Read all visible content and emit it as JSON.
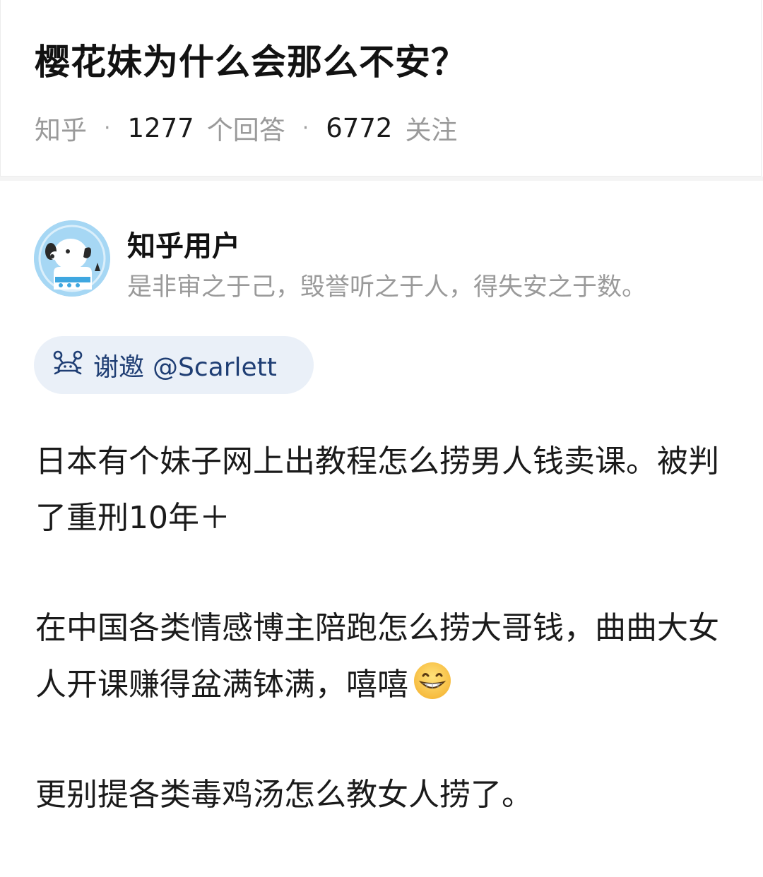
{
  "question": {
    "title": "樱花妹为什么会那么不安？",
    "source": "知乎",
    "answers_count": "1277",
    "answers_label": "个回答",
    "followers_count": "6772",
    "followers_label": "关注"
  },
  "author": {
    "name": "知乎用户",
    "bio": "是非审之于己，毁誉听之于人，得失安之于数。",
    "avatar_icon": "dog-avatar-icon"
  },
  "invite": {
    "icon": "crab-icon",
    "label": "谢邀",
    "handle": "@Scarlett",
    "text_color": "#1f3e74",
    "bg_color": "#eaf0f8"
  },
  "answer": {
    "paragraph_1": "日本有个妹子网上出教程怎么捞男人钱卖课。被判了重刑10年＋",
    "paragraph_2": "在中国各类情感博主陪跑怎么捞大哥钱，曲曲大女人开课赚得盆满钵满，嘻嘻",
    "paragraph_2_emoji": "grinning-face-icon",
    "paragraph_3": "更别提各类毒鸡汤怎么教女人捞了。"
  }
}
